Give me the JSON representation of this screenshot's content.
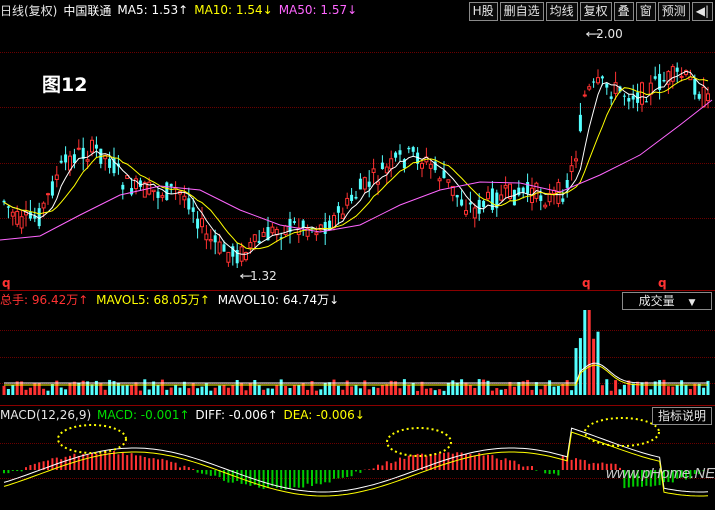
{
  "header": {
    "period": "日线(复权)",
    "stock": "中国联通",
    "ma5": "MA5: 1.53↑",
    "ma10": "MA10: 1.54↓",
    "ma50": "MA50: 1.57↓"
  },
  "toolbar": [
    "H股",
    "删自选",
    "均线",
    "复权",
    "叠",
    "窗",
    "预测",
    "◀|"
  ],
  "figure_label": "图12",
  "price_annotations": {
    "high": "2.00",
    "low": "1.32"
  },
  "markers": [
    "q",
    "q",
    "q"
  ],
  "volume": {
    "total": "总手: 96.42万↑",
    "mavol5": "MAVOL5: 68.05万↑",
    "mavol10": "MAVOL10: 64.74万↓",
    "dropdown": "成交量"
  },
  "macd": {
    "title": "MACD(12,26,9)",
    "macd": "MACD: -0.001↑",
    "diff": "DIFF: -0.006↑",
    "dea": "DEA: -0.006↓",
    "help_button": "指标说明"
  },
  "watermark": "www.pHome.NET",
  "colors": {
    "up": "#ff3232",
    "down": "#54ffff",
    "ma5": "#ffffff",
    "ma10": "#ffff00",
    "ma50": "#ff66ff",
    "macd_neg": "#00cc00",
    "highlight_circle": "#ffff00"
  }
}
